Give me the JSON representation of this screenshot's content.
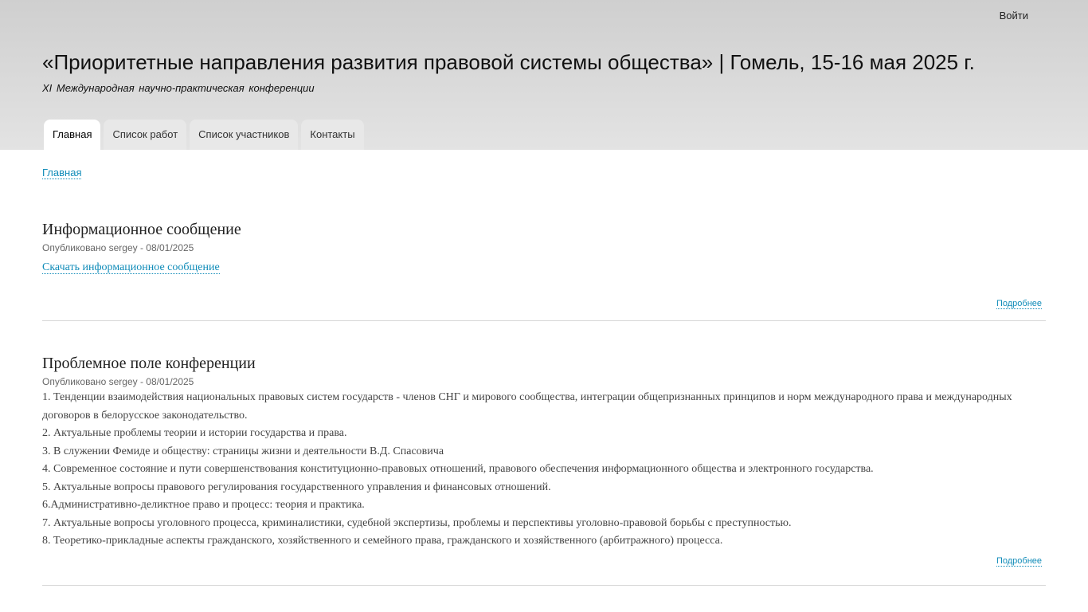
{
  "header": {
    "login_label": "Войти",
    "site_name": "«Приоритетные направления развития правовой системы общества» | Гомель, 15-16 мая 2025 г.",
    "slogan": "XI Международная научно-практическая конференции",
    "tabs": [
      {
        "label": "Главная",
        "active": true
      },
      {
        "label": "Список работ",
        "active": false
      },
      {
        "label": "Список участников",
        "active": false
      },
      {
        "label": "Контакты",
        "active": false
      }
    ]
  },
  "breadcrumb": "Главная",
  "nodes": [
    {
      "title": "Информационное сообщение",
      "submitted": "Опубликовано sergey - 08/01/2025",
      "link_label": "Скачать информационное сообщение",
      "more_label": "Подробнее"
    },
    {
      "title": "Проблемное поле конференции",
      "submitted": "Опубликовано sergey - 08/01/2025",
      "topics": [
        "1. Тенденции взаимодействия национальных правовых систем государств - членов СНГ и мирового сообщества, интеграции общепризнанных принципов и норм международного права и международных договоров в белорусское законодательство.",
        "2. Актуальные проблемы теории и истории государства и права.",
        "3. В служении Фемиде и обществу: страницы жизни и деятельности В.Д. Спасовича",
        "4. Современное состояние и пути совершенствования конституционно-правовых отношений, правового обеспечения информационного общества и электронного государства.",
        "5. Актуальные вопросы правового регулирования государственного управления и финансовых отношений.",
        "6.Административно-деликтное право и процесс: теория и практика.",
        "7. Актуальные вопросы уголовного процесса, криминалистики, судебной экспертизы, проблемы и перспективы уголовно-правовой борьбы с преступностью.",
        "8. Теоретико-прикладные аспекты гражданского, хозяйственного и семейного права, гражданского и хозяйственного (арбитражного) процесса."
      ],
      "more_label": "Подробнее"
    }
  ]
}
